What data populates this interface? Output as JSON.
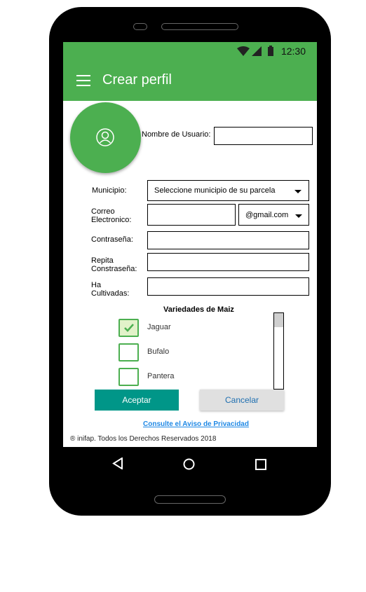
{
  "status_bar": {
    "time": "12:30"
  },
  "app_bar": {
    "title": "Crear perfil"
  },
  "form": {
    "username_label": "Nombre de Usuario:",
    "municipio_label": "Municipio:",
    "municipio_select": "Seleccione municipio de su parcela",
    "email_label_line1": "Correo",
    "email_label_line2": "Electronico:",
    "email_domain": "@gmail.com",
    "password_label": "Contraseña:",
    "repeat_label_line1": "Repita",
    "repeat_label_line2": "Constraseña:",
    "ha_label_line1": "Ha",
    "ha_label_line2": "Cultivadas:"
  },
  "varieties": {
    "title": "Variedades de Maiz",
    "items": [
      {
        "label": "Jaguar",
        "checked": true
      },
      {
        "label": "Bufalo",
        "checked": false
      },
      {
        "label": "Pantera",
        "checked": false
      }
    ]
  },
  "buttons": {
    "accept": "Aceptar",
    "cancel": "Cancelar"
  },
  "privacy_link": "Consulte el Aviso de Privacidad",
  "footer": "® inifap. Todos los Derechos Reservados 2018",
  "icons": [
    "wifi-icon",
    "signal-icon",
    "battery-icon",
    "menu-icon",
    "user-icon",
    "back-icon",
    "home-icon",
    "recents-icon",
    "check-icon"
  ],
  "colors": {
    "primary": "#4caf50",
    "accent": "#009688",
    "link": "#1e88e5"
  }
}
